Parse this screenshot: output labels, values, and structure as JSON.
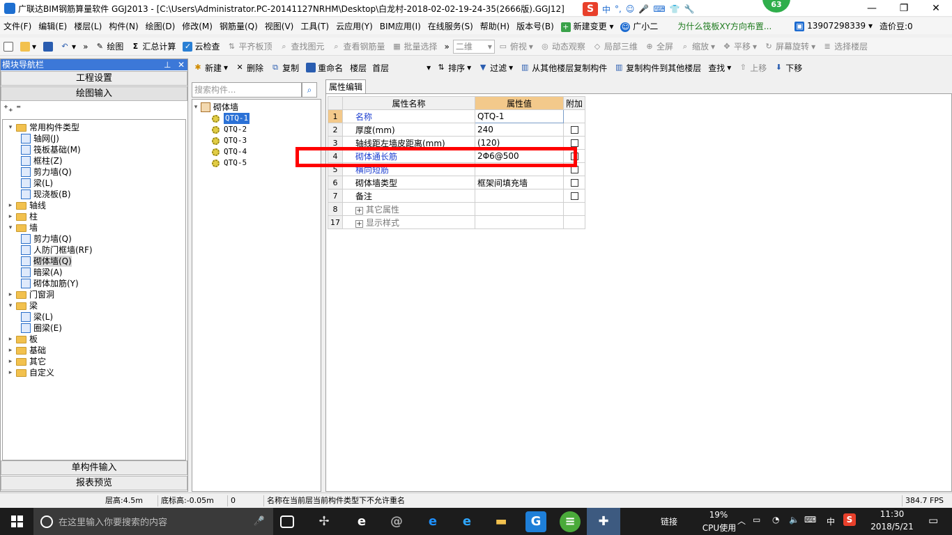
{
  "window": {
    "title": "广联达BIM钢筋算量软件 GGJ2013 - [C:\\Users\\Administrator.PC-20141127NRHM\\Desktop\\白龙村-2018-02-02-19-24-35(2666版).GGJ12]",
    "badge": "63",
    "min": "—",
    "max": "❐",
    "close": "✕"
  },
  "ime": {
    "lang": "中",
    "p1": "°,",
    "p2": "☺",
    "p3": "🎤",
    "p4": "⌨",
    "p5": "👕",
    "p6": "🔧"
  },
  "menu": [
    "文件(F)",
    "编辑(E)",
    "楼层(L)",
    "构件(N)",
    "绘图(D)",
    "修改(M)",
    "钢筋量(Q)",
    "视图(V)",
    "工具(T)",
    "云应用(Y)",
    "BIM应用(I)",
    "在线服务(S)",
    "帮助(H)",
    "版本号(B)",
    "新建变更",
    "广小二",
    "为什么筏板XY方向布置...",
    "13907298339",
    "造价豆:0"
  ],
  "toolbar1": {
    "draw": "绘图",
    "sum": "汇总计算",
    "cloud": "云检查",
    "align": "平齐板顶",
    "findfig": "查找图元",
    "viewrebar": "查看钢筋量",
    "batch": "批量选择",
    "viewmode": "二维",
    "topview": "俯视",
    "dynamic": "动态观察",
    "local3d": "局部三维",
    "fullscreen": "全屏",
    "zoom": "缩放",
    "pan": "平移",
    "rotate": "屏幕旋转",
    "floorsel": "选择楼层"
  },
  "toolbar2": {
    "new": "新建",
    "delete": "删除",
    "copy": "复制",
    "rename": "重命名",
    "floor_label": "楼层",
    "floor": "首层",
    "sort": "排序",
    "filter": "过滤",
    "copy_from": "从其他楼层复制构件",
    "copy_to": "复制构件到其他楼层",
    "find": "查找",
    "up": "上移",
    "down": "下移"
  },
  "nav": {
    "title": "模块导航栏",
    "pin": "⊥",
    "close": "✕",
    "proj": "工程设置",
    "draw": "绘图输入",
    "single": "单构件输入",
    "report": "报表预览",
    "tree": [
      {
        "lvl": 0,
        "t": "▾",
        "f": true,
        "l": "常用构件类型"
      },
      {
        "lvl": 1,
        "l": "轴网(J)"
      },
      {
        "lvl": 1,
        "l": "筏板基础(M)"
      },
      {
        "lvl": 1,
        "l": "框柱(Z)"
      },
      {
        "lvl": 1,
        "l": "剪力墙(Q)"
      },
      {
        "lvl": 1,
        "l": "梁(L)"
      },
      {
        "lvl": 1,
        "l": "现浇板(B)"
      },
      {
        "lvl": 0,
        "t": "▸",
        "f": true,
        "l": "轴线"
      },
      {
        "lvl": 0,
        "t": "▸",
        "f": true,
        "l": "柱"
      },
      {
        "lvl": 0,
        "t": "▾",
        "f": true,
        "l": "墙"
      },
      {
        "lvl": 1,
        "l": "剪力墙(Q)"
      },
      {
        "lvl": 1,
        "l": "人防门框墙(RF)"
      },
      {
        "lvl": 1,
        "l": "砌体墙(Q)",
        "sel": true
      },
      {
        "lvl": 1,
        "l": "暗梁(A)"
      },
      {
        "lvl": 1,
        "l": "砌体加筋(Y)"
      },
      {
        "lvl": 0,
        "t": "▸",
        "f": true,
        "l": "门窗洞"
      },
      {
        "lvl": 0,
        "t": "▾",
        "f": true,
        "l": "梁"
      },
      {
        "lvl": 1,
        "l": "梁(L)"
      },
      {
        "lvl": 1,
        "l": "圈梁(E)"
      },
      {
        "lvl": 0,
        "t": "▸",
        "f": true,
        "l": "板"
      },
      {
        "lvl": 0,
        "t": "▸",
        "f": true,
        "l": "基础"
      },
      {
        "lvl": 0,
        "t": "▸",
        "f": true,
        "l": "其它"
      },
      {
        "lvl": 0,
        "t": "▸",
        "f": true,
        "l": "自定义"
      }
    ]
  },
  "components": {
    "search_placeholder": "搜索构件...",
    "root": "砌体墙",
    "items": [
      "QTQ-1",
      "QTQ-2",
      "QTQ-3",
      "QTQ-4",
      "QTQ-5"
    ]
  },
  "props": {
    "tab": "属性编辑",
    "h_name": "属性名称",
    "h_val": "属性值",
    "h_add": "附加",
    "rows": [
      {
        "n": "1",
        "name": "名称",
        "val": "QTQ-1",
        "chk": false,
        "blue": true,
        "cur": true
      },
      {
        "n": "2",
        "name": "厚度(mm)",
        "val": "240",
        "chk": true
      },
      {
        "n": "3",
        "name": "轴线距左墙皮距离(mm)",
        "val": "(120)",
        "chk": true
      },
      {
        "n": "4",
        "name": "砌体通长筋",
        "val": "2Φ6@500",
        "chk": true,
        "blue": true
      },
      {
        "n": "5",
        "name": "横向短筋",
        "val": "",
        "chk": true,
        "blue": true
      },
      {
        "n": "6",
        "name": "砌体墙类型",
        "val": "框架间填充墙",
        "chk": true
      },
      {
        "n": "7",
        "name": "备注",
        "val": "",
        "chk": true
      },
      {
        "n": "8",
        "name": "其它属性",
        "val": "",
        "exp": true
      },
      {
        "n": "17",
        "name": "显示样式",
        "val": "",
        "exp": true
      }
    ]
  },
  "status": {
    "height": "层高:4.5m",
    "base": "底标高:-0.05m",
    "zero": "0",
    "msg": "名称在当前层当前构件类型下不允许重名",
    "fps": "384.7 FPS"
  },
  "taskbar": {
    "search": "在这里输入你要搜索的内容",
    "link": "链接",
    "cpu": "19%",
    "cpu_label": "CPU使用",
    "lang": "中",
    "time": "11:30",
    "date": "2018/5/21"
  },
  "colors": {
    "accent": "#3c78d8",
    "highlight": "#f3c98b",
    "red_box": "#ff0000"
  }
}
